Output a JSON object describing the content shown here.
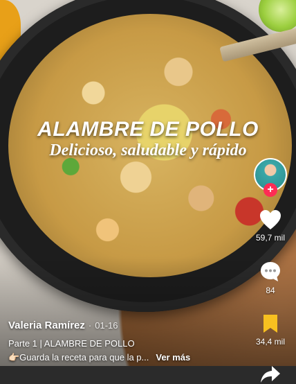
{
  "video": {
    "title": "ALAMBRE DE POLLO",
    "subtitle": "Delicioso, saludable y rápido"
  },
  "sidebar": {
    "likes": "59,7 mil",
    "comments": "84",
    "saves": "34,4 mil",
    "follow_symbol": "+"
  },
  "post": {
    "author": "Valeria Ramírez",
    "separator": "·",
    "date": "01-16",
    "caption_line1": "Parte 1 | ALAMBRE DE POLLO",
    "caption_line2": "👉🏻Guarda la receta para que la p...",
    "more_label": "Ver más"
  },
  "colors": {
    "accent": "#fe2c55",
    "bookmark_active": "#f7c020"
  }
}
